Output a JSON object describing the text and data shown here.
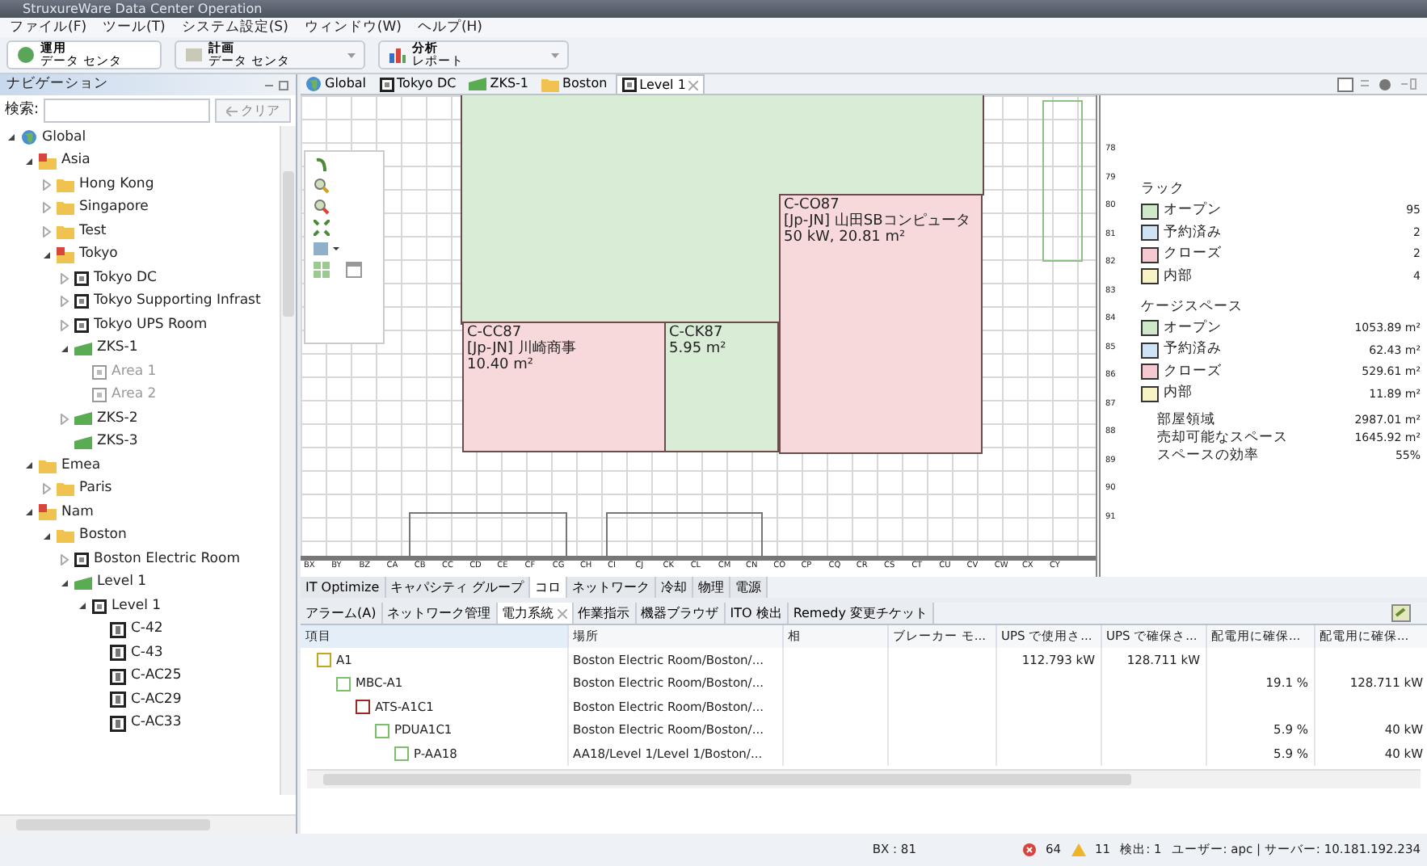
{
  "window": {
    "title": "StruxureWare Data Center Operation"
  },
  "menu": [
    "ファイル(F)",
    "ツール(T)",
    "システム設定(S)",
    "ウィンドウ(W)",
    "ヘルプ(H)"
  ],
  "perspectives": [
    {
      "kind": "ops",
      "title": "運用",
      "subtitle": "データ センタ",
      "selected": true,
      "dropdown": false
    },
    {
      "kind": "plan",
      "title": "計画",
      "subtitle": "データ センタ",
      "selected": false,
      "dropdown": true
    },
    {
      "kind": "report",
      "title": "分析",
      "subtitle": "レポート",
      "selected": false,
      "dropdown": true
    }
  ],
  "navigation": {
    "title": "ナビゲーション",
    "search_label": "検索:",
    "clear_button": "クリア",
    "tree": [
      {
        "kind": "globe",
        "label": "Global",
        "expanded": true,
        "children": [
          {
            "kind": "site",
            "label": "Asia",
            "expanded": true,
            "children": [
              {
                "kind": "folder",
                "label": "Hong Kong",
                "expanded": false
              },
              {
                "kind": "folder",
                "label": "Singapore",
                "expanded": false
              },
              {
                "kind": "folder",
                "label": "Test",
                "expanded": false
              },
              {
                "kind": "site",
                "label": "Tokyo",
                "expanded": true,
                "children": [
                  {
                    "kind": "room",
                    "label": "Tokyo DC",
                    "expanded": false
                  },
                  {
                    "kind": "room",
                    "label": "Tokyo Supporting Infrast",
                    "expanded": false
                  },
                  {
                    "kind": "room",
                    "label": "Tokyo UPS Room",
                    "expanded": false
                  },
                  {
                    "kind": "cage",
                    "label": "ZKS-1",
                    "expanded": true,
                    "children": [
                      {
                        "kind": "area",
                        "label": "Area 1",
                        "dimmed": true
                      },
                      {
                        "kind": "area",
                        "label": "Area 2",
                        "dimmed": true
                      }
                    ]
                  },
                  {
                    "kind": "cage",
                    "label": "ZKS-2",
                    "expanded": false
                  },
                  {
                    "kind": "cage",
                    "label": "ZKS-3"
                  }
                ]
              }
            ]
          },
          {
            "kind": "folder",
            "label": "Emea",
            "expanded": true,
            "children": [
              {
                "kind": "folder",
                "label": "Paris",
                "expanded": false
              }
            ]
          },
          {
            "kind": "site",
            "label": "Nam",
            "expanded": true,
            "children": [
              {
                "kind": "folder",
                "label": "Boston",
                "expanded": true,
                "children": [
                  {
                    "kind": "room",
                    "label": "Boston Electric Room",
                    "expanded": false
                  },
                  {
                    "kind": "cage",
                    "label": "Level 1",
                    "expanded": true,
                    "children": [
                      {
                        "kind": "room",
                        "label": "Level 1",
                        "expanded": true,
                        "children": [
                          {
                            "kind": "rack",
                            "label": "C-42"
                          },
                          {
                            "kind": "rack",
                            "label": "C-43"
                          },
                          {
                            "kind": "rack",
                            "label": "C-AC25"
                          },
                          {
                            "kind": "rack",
                            "label": "C-AC29"
                          },
                          {
                            "kind": "rack",
                            "label": "C-AC33"
                          }
                        ]
                      }
                    ]
                  }
                ]
              }
            ]
          }
        ]
      }
    ]
  },
  "editor_tabs": [
    {
      "kind": "globe",
      "label": "Global",
      "selected": false
    },
    {
      "kind": "room",
      "label": "Tokyo DC",
      "selected": false
    },
    {
      "kind": "cage",
      "label": "ZKS-1",
      "selected": false
    },
    {
      "kind": "folder",
      "label": "Boston",
      "selected": false
    },
    {
      "kind": "room",
      "label": "Level 1",
      "selected": true
    }
  ],
  "floor_plan": {
    "rooms": [
      {
        "color": "#d9ecd6"
      },
      {
        "color": "#f7d9dc",
        "lines": [
          "C-CO87",
          "[Jp-JN] 山田SBコンピュータ",
          "50 kW, 20.81 m²"
        ]
      },
      {
        "color": "#f7d9dc",
        "lines": [
          "C-CC87",
          "[Jp-JN] 川崎商事",
          "10.40 m²"
        ]
      },
      {
        "color": "#d9ecd6",
        "lines": [
          "C-CK87",
          "5.95 m²"
        ]
      }
    ],
    "row_labels": [
      "78",
      "79",
      "80",
      "81",
      "82",
      "83",
      "84",
      "85",
      "86",
      "87",
      "88",
      "89",
      "90",
      "91"
    ],
    "column_labels": [
      "BX",
      "BY",
      "BZ",
      "CA",
      "CB",
      "CC",
      "CD",
      "CE",
      "CF",
      "CG",
      "CH",
      "CI",
      "CJ",
      "CK",
      "CL",
      "CM",
      "CN",
      "CO",
      "CP",
      "CQ",
      "CR",
      "CS",
      "CT",
      "CU",
      "CV",
      "CW",
      "CX",
      "CY"
    ]
  },
  "legend": {
    "rack_title": "ラック",
    "rack_items": [
      {
        "label": "オープン",
        "value": "95",
        "color": "#cfe8c9"
      },
      {
        "label": "予約済み",
        "value": "2",
        "color": "#cfe3f5"
      },
      {
        "label": "クローズ",
        "value": "2",
        "color": "#f5c9cf"
      },
      {
        "label": "内部",
        "value": "4",
        "color": "#f7f3c4"
      }
    ],
    "cage_title": "ケージスペース",
    "cage_items": [
      {
        "label": "オープン",
        "value": "1053.89 m²",
        "color": "#cfe8c9"
      },
      {
        "label": "予約済み",
        "value": "62.43 m²",
        "color": "#cfe3f5"
      },
      {
        "label": "クローズ",
        "value": "529.61 m²",
        "color": "#f5c9cf"
      },
      {
        "label": "内部",
        "value": "11.89 m²",
        "color": "#f7f3c4"
      }
    ],
    "summary": [
      {
        "label": "部屋領域",
        "value": "2987.01 m²"
      },
      {
        "label": "売却可能なスペース",
        "value": "1645.92 m²"
      },
      {
        "label": "スペースの効率",
        "value": "55%"
      }
    ]
  },
  "view_tabs": [
    {
      "label": "IT Optimize",
      "selected": false
    },
    {
      "label": "キャパシティ グループ",
      "selected": false
    },
    {
      "label": "コロ",
      "selected": true
    },
    {
      "label": "ネットワーク",
      "selected": false
    },
    {
      "label": "冷却",
      "selected": false
    },
    {
      "label": "物理",
      "selected": false
    },
    {
      "label": "電源",
      "selected": false
    }
  ],
  "bottom_tabs": [
    {
      "label": "アラーム(A)",
      "selected": false
    },
    {
      "label": "ネットワーク管理",
      "selected": false
    },
    {
      "label": "電力系統",
      "selected": true
    },
    {
      "label": "作業指示",
      "selected": false
    },
    {
      "label": "機器ブラウザ",
      "selected": false
    },
    {
      "label": "ITO 検出",
      "selected": false
    },
    {
      "label": "Remedy 変更チケット",
      "selected": false
    }
  ],
  "power_table": {
    "columns": [
      "項目",
      "場所",
      "相",
      "ブレーカー モ...",
      "UPS で使用さ...",
      "UPS で確保さ...",
      "配電用に確保...",
      "配電用に確保..."
    ],
    "rows": [
      {
        "cells": [
          "A1",
          "Boston Electric Room/Boston/...",
          "",
          "",
          "112.793 kW",
          "128.711 kW",
          "",
          ""
        ],
        "color": "#c9a227",
        "children": [
          {
            "cells": [
              "MBC-A1",
              "Boston Electric Room/Boston/...",
              "",
              "",
              "",
              "",
              "19.1 %",
              "128.711 kW"
            ],
            "color": "#7bbf6a",
            "children": [
              {
                "cells": [
                  "ATS-A1C1",
                  "Boston Electric Room/Boston/...",
                  "",
                  "",
                  "",
                  "",
                  "",
                  ""
                ],
                "color": "#9b2a1e",
                "children": [
                  {
                    "cells": [
                      "PDUA1C1",
                      "Boston Electric Room/Boston/...",
                      "",
                      "",
                      "",
                      "",
                      "5.9 %",
                      "40 kW"
                    ],
                    "color": "#7bbf6a",
                    "children": [
                      {
                        "cells": [
                          "P-AA18",
                          "AA18/Level 1/Level 1/Boston/...",
                          "",
                          "",
                          "",
                          "",
                          "5.9 %",
                          "40 kW"
                        ],
                        "color": "#7bbf6a"
                      }
                    ]
                  }
                ]
              }
            ]
          }
        ]
      }
    ]
  },
  "status_bar": {
    "cursor": "BX : 81",
    "errors": "64",
    "warnings": "11",
    "detected": "検出: 1",
    "session": "ユーザー: apc | サーバー: 10.181.192.234"
  }
}
